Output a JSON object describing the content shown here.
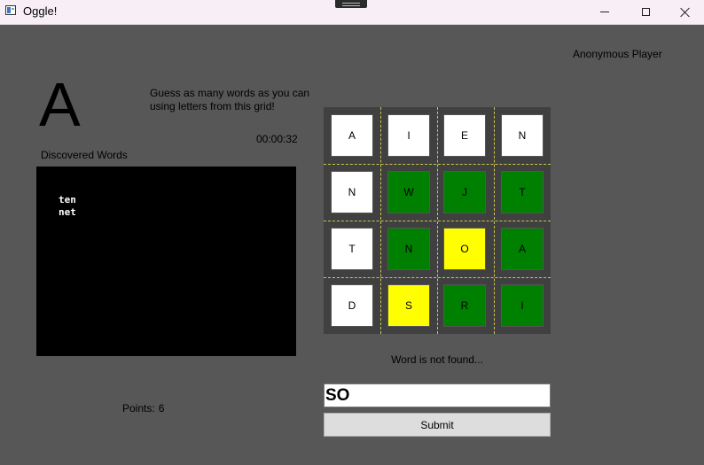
{
  "window": {
    "title": "Oggle!"
  },
  "player": {
    "name": "Anonymous Player"
  },
  "game": {
    "current_letter": "A",
    "instructions": "Guess as many words as you can using letters from this grid!",
    "timer": "00:00:32",
    "discovered_heading": "Discovered Words",
    "discovered_words": [
      "ten",
      "net"
    ],
    "points_label": "Points:",
    "points_value": "6",
    "status_message": "Word is not found...",
    "input_value": "SO",
    "submit_label": "Submit"
  },
  "colors": {
    "white": "#ffffff",
    "green": "#008000",
    "yellow": "#ffff00"
  },
  "grid": [
    [
      {
        "letter": "A",
        "state": "white"
      },
      {
        "letter": "I",
        "state": "white"
      },
      {
        "letter": "E",
        "state": "white"
      },
      {
        "letter": "N",
        "state": "white"
      }
    ],
    [
      {
        "letter": "N",
        "state": "white"
      },
      {
        "letter": "W",
        "state": "green"
      },
      {
        "letter": "J",
        "state": "green"
      },
      {
        "letter": "T",
        "state": "green"
      }
    ],
    [
      {
        "letter": "T",
        "state": "white"
      },
      {
        "letter": "N",
        "state": "green"
      },
      {
        "letter": "O",
        "state": "yellow"
      },
      {
        "letter": "A",
        "state": "green"
      }
    ],
    [
      {
        "letter": "D",
        "state": "white"
      },
      {
        "letter": "S",
        "state": "yellow"
      },
      {
        "letter": "R",
        "state": "green"
      },
      {
        "letter": "I",
        "state": "green"
      }
    ]
  ]
}
